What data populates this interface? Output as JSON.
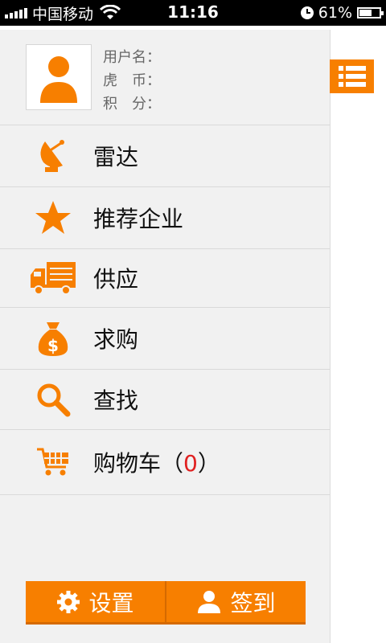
{
  "status_bar": {
    "carrier": "中国移动",
    "time": "11:16",
    "battery": "61%",
    "battery_level": 0.61
  },
  "profile": {
    "username_label": "用户名：",
    "huobi_label": "虎　币：",
    "points_label": "积　分："
  },
  "menu": {
    "radar": "雷达",
    "recommended": "推荐企业",
    "supply": "供应",
    "purchase": "求购",
    "search": "查找",
    "cart_prefix": "购物车（",
    "cart_count": "0",
    "cart_suffix": "）"
  },
  "bottom": {
    "settings": "设置",
    "checkin": "签到"
  },
  "colors": {
    "accent": "#f77f00",
    "count": "#e02020"
  }
}
